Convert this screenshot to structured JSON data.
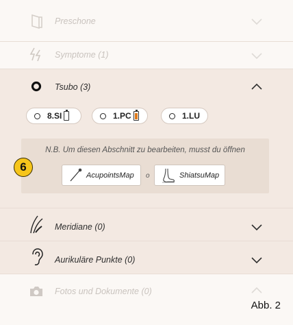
{
  "sections": {
    "preschone": {
      "label": "Preschone",
      "icon": "door-icon"
    },
    "symptome": {
      "label": "Symptome (1)",
      "icon": "lightning-icon"
    },
    "tsubo": {
      "label": "Tsubo (3)",
      "icon": "ring-icon"
    },
    "meridiane": {
      "label": "Meridiane (0)",
      "icon": "meridian-lines-icon"
    },
    "aurikulaere": {
      "label": "Aurikuläre Punkte (0)",
      "icon": "ear-icon"
    },
    "fotos": {
      "label": "Fotos und Dokumente (0)",
      "icon": "camera-icon"
    }
  },
  "tsubo_points": [
    {
      "label": "8.SI",
      "battery": "empty"
    },
    {
      "label": "1.PC",
      "battery": "orange"
    },
    {
      "label": "1.LU",
      "battery": "none"
    }
  ],
  "note": {
    "text": "N.B. Um diesen Abschnitt zu bearbeiten, musst du öffnen",
    "acupoints_label": "AcupointsMap",
    "or_label": "o",
    "shiatsu_label": "ShiatsuMap"
  },
  "badge": "6",
  "figure_label": "Abb. 2",
  "colors": {
    "panel": "#f3e9e2",
    "note_box": "#e9ddd3",
    "badge": "#f6c51b",
    "battery_orange": "#e07a1a"
  }
}
